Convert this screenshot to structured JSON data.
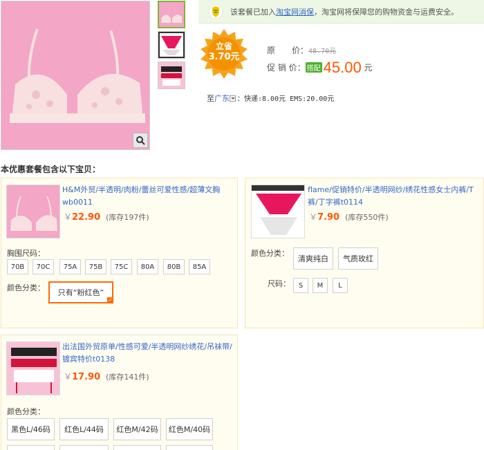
{
  "notice": {
    "text_before": "该套餐已加入",
    "link": "淘宝网消保",
    "text_after": "，淘宝网将保障您的购物资金与运费安全。"
  },
  "badge": {
    "line1": "立省",
    "line2": "3.70元"
  },
  "prices": {
    "original_label": "原　　价：",
    "original_value": "48.70元",
    "promo_label": "促 销 价：",
    "promo_tag": "搭配",
    "promo_value": "45.00",
    "promo_unit": "元"
  },
  "shipping": {
    "prefix": "至",
    "region": "广东",
    "detail": "：快递:8.00元 EMS:20.00元"
  },
  "section_title": "本优惠套餐包含以下宝贝：",
  "products": [
    {
      "title": "H&M外贸/半透明/肉粉/蕾丝可爱性感/超薄文胸wb0011",
      "currency": "￥",
      "price": "22.90",
      "stock": "(库存197件)",
      "size_label": "胸围尺码：",
      "sizes": [
        "70B",
        "70C",
        "75A",
        "75B",
        "75C",
        "80A",
        "80B",
        "85A"
      ],
      "color_label": "颜色分类：",
      "colors": [
        "只有“粉红色”"
      ]
    },
    {
      "title": "flame/促销特价/半透明网纱/绣花性感女士内裤/T裤/丁字裤t0114",
      "currency": "￥",
      "price": "7.90",
      "stock": "(库存550件)",
      "color_label": "颜色分类：",
      "colors": [
        "清爽纯白",
        "气质玫红"
      ],
      "size_label": "尺码：",
      "sizes": [
        "S",
        "M",
        "L"
      ]
    },
    {
      "title": "出法国外贸原单/性感可爱/半透明网纱绣花/吊袜带/镀宾特价t0138",
      "currency": "￥",
      "price": "17.90",
      "stock": "(库存141件)",
      "color_label": "颜色分类：",
      "colors": [
        "黑色L/46码",
        "红色L/44码",
        "红色M/42码",
        "红色M/40码"
      ]
    }
  ]
}
